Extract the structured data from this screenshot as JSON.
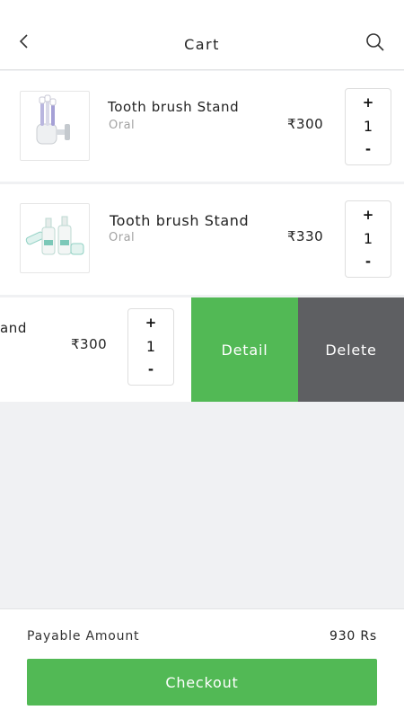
{
  "header": {
    "title": "Cart",
    "back_icon": "chevron-left-icon",
    "search_icon": "search-icon"
  },
  "items": [
    {
      "name": "Tooth brush Stand",
      "category": "Oral",
      "currency": "₹",
      "price": "300",
      "qty": "1",
      "plus": "+",
      "minus": "-",
      "image": "toothbrush-holder-image"
    },
    {
      "name": "Tooth brush Stand",
      "category": "Oral",
      "currency": "₹",
      "price": "330",
      "qty": "1",
      "plus": "+",
      "minus": "-",
      "image": "skincare-set-image"
    },
    {
      "name_fragment": "and",
      "currency": "₹",
      "price": "300",
      "qty": "1",
      "plus": "+",
      "minus": "-"
    }
  ],
  "swipe_actions": {
    "detail_label": "Detail",
    "delete_label": "Delete",
    "detail_color": "#52b955",
    "delete_color": "#5e5f62"
  },
  "footer": {
    "payable_label": "Payable Amount",
    "payable_value": "930 Rs",
    "checkout_label": "Checkout"
  },
  "colors": {
    "accent": "#52b955",
    "background": "#f0f1f3"
  }
}
